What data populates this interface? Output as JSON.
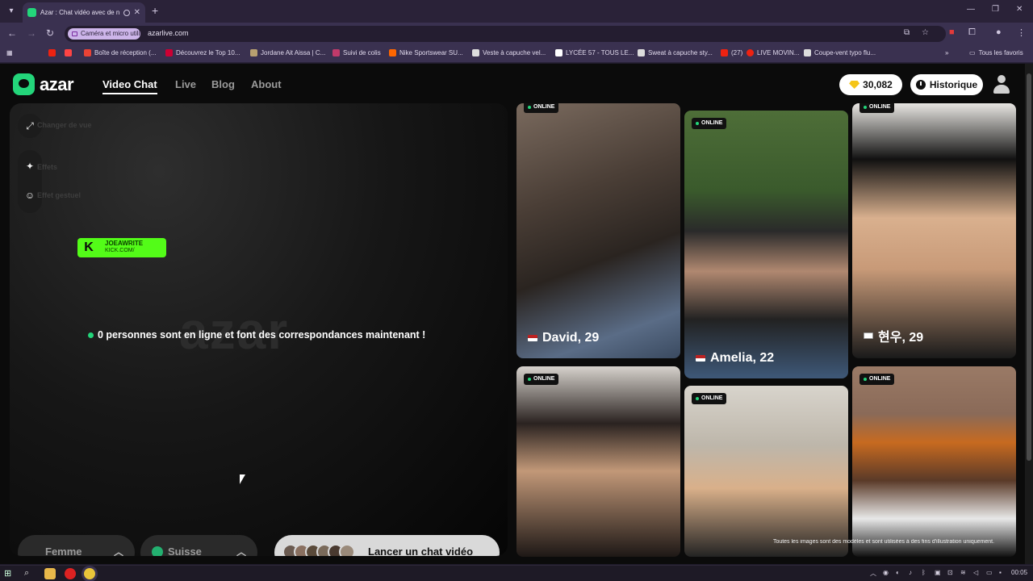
{
  "browser": {
    "tab_title": "Azar : Chat vidéo avec de nouvelles personnes",
    "url": "azarlive.com",
    "permission_chip": "Caméra et micro utilisés",
    "bookmarks": [
      "Boîte de réception (...",
      "Découvrez le Top 10...",
      "Jordane Ait Aissa | C...",
      "Suivi de colis",
      "Nike Sportswear SU...",
      "Veste à capuche vel...",
      "LYCÉE 57 - TOUS LE...",
      "Sweat à capuche sty...",
      "(27)",
      "LIVE MOVIN...",
      "Coupe-vent typo flu..."
    ],
    "all_bookmarks": "Tous les favoris"
  },
  "site": {
    "logo": "azar",
    "nav": {
      "video_chat": "Video Chat",
      "live": "Live",
      "blog": "Blog",
      "about": "About"
    },
    "coins": "30,082",
    "history": "Historique",
    "side_controls": {
      "change_view": "Changer de vue",
      "effects": "Effets",
      "gesture_effect": "Effet gestuel"
    },
    "kick_badge": {
      "name": "JOEAWRITE",
      "url": "KICK.COM/"
    },
    "watermark": "azar",
    "online_message": "0 personnes sont en ligne et font des correspondances maintenant !",
    "gender_filter": "Femme",
    "country_filter": "Suisse",
    "start_button": "Lancer un chat vidéo",
    "disclaimer": "Toutes les images sont des modèles et sont utilisées à des fins d'illustration uniquement.",
    "cards": [
      {
        "status": "ONLINE",
        "name": "David, 29",
        "flag": "us"
      },
      {
        "status": "ONLINE",
        "name": "Amelia, 22",
        "flag": "us"
      },
      {
        "status": "ONLINE",
        "name": "현우, 29",
        "flag": "kr"
      },
      {
        "status": "ONLINE",
        "name": "",
        "flag": ""
      },
      {
        "status": "ONLINE",
        "name": "",
        "flag": ""
      },
      {
        "status": "ONLINE",
        "name": "",
        "flag": ""
      }
    ]
  },
  "taskbar": {
    "time": "00:05"
  },
  "colors": {
    "accent_green": "#23d57a",
    "kick_green": "#53fc18",
    "coin_gold": "#f5c518"
  }
}
